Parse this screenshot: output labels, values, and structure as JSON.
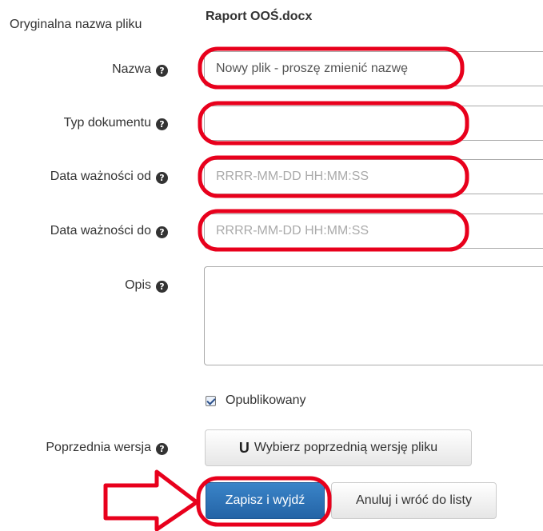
{
  "form": {
    "original_name": {
      "label": "Oryginalna nazwa pliku",
      "value": "Raport OOŚ.docx"
    },
    "name": {
      "label": "Nazwa",
      "value": "Nowy plik - proszę zmienić nazwę"
    },
    "doc_type": {
      "label": "Typ dokumentu",
      "value": ""
    },
    "valid_from": {
      "label": "Data ważności od",
      "placeholder": "RRRR-MM-DD HH:MM:SS"
    },
    "valid_to": {
      "label": "Data ważności do",
      "placeholder": "RRRR-MM-DD HH:MM:SS"
    },
    "description": {
      "label": "Opis",
      "value": ""
    },
    "published": {
      "label": "Opublikowany",
      "checked": true
    },
    "previous_version": {
      "label": "Poprzednia wersja",
      "button_label": "Wybierz poprzednią wersję pliku",
      "button_icon": "magnet-icon"
    }
  },
  "help_icon_glyph": "?",
  "actions": {
    "save_label": "Zapisz i wyjdź",
    "cancel_label": "Anuluj i wróć do listy"
  },
  "colors": {
    "primary": "#2c6fb3",
    "highlight": "#e8001c"
  }
}
